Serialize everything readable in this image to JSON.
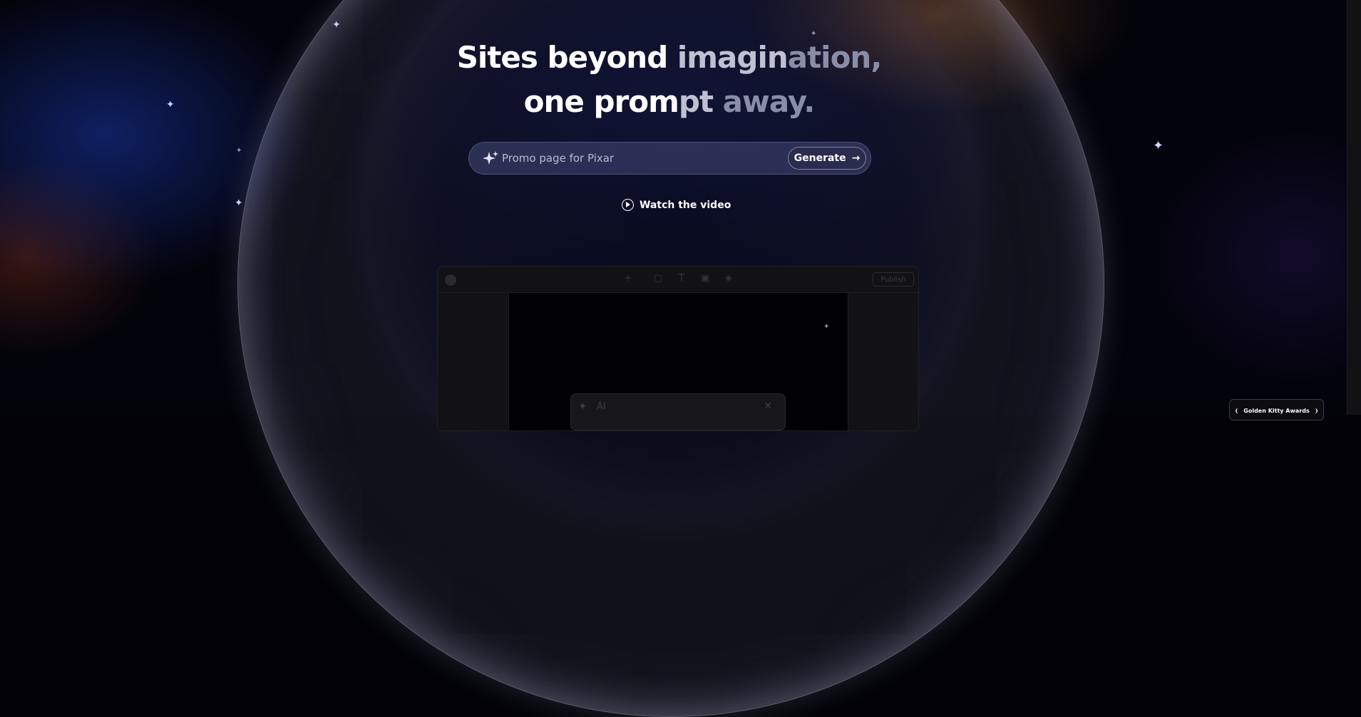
{
  "hero": {
    "line1_bright": "Sites beyond",
    "line1_fade1": " imagin",
    "line1_fade2": "ation,",
    "line2_bright": "one prom",
    "line2_mid": "pt",
    "line2_fade": " away."
  },
  "prompt": {
    "value": "Promo page for Pixar",
    "icon": "sparkles-icon",
    "generate_label": "Generate",
    "generate_icon": "arrow-right-icon"
  },
  "watch": {
    "label": "Watch the video",
    "icon": "play-circle-icon"
  },
  "editor": {
    "publish_label": "Publish",
    "ai_label": "AI",
    "tools": [
      "+",
      "▢",
      "T",
      "▣",
      "◈"
    ]
  },
  "badge": {
    "label": "Golden Kitty Awards",
    "icon": "laurel-icon"
  },
  "colors": {
    "background": "#03030b",
    "accent_blue": "#1937aa",
    "accent_orange": "#8c501e"
  }
}
